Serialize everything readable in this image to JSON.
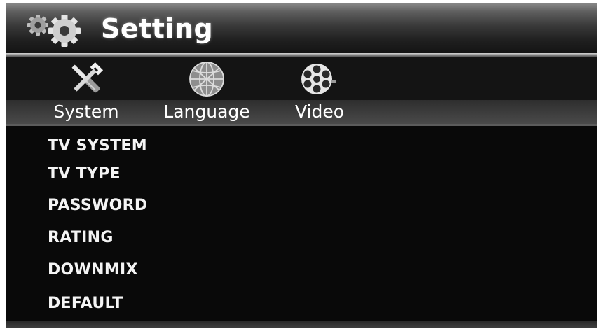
{
  "header": {
    "title": "Setting"
  },
  "tabs": [
    {
      "label": "System",
      "icon": "tools-icon"
    },
    {
      "label": "Language",
      "icon": "globe-icon"
    },
    {
      "label": "Video",
      "icon": "film-reel-icon"
    }
  ],
  "menu": {
    "items": [
      {
        "label": "TV SYSTEM"
      },
      {
        "label": "TV TYPE"
      },
      {
        "label": "PASSWORD"
      },
      {
        "label": "RATING"
      },
      {
        "label": "DOWNMIX"
      },
      {
        "label": "DEFAULT"
      }
    ]
  },
  "colors": {
    "background": "#090909",
    "text": "#ffffff",
    "title_bar": "#3a3a3a"
  }
}
